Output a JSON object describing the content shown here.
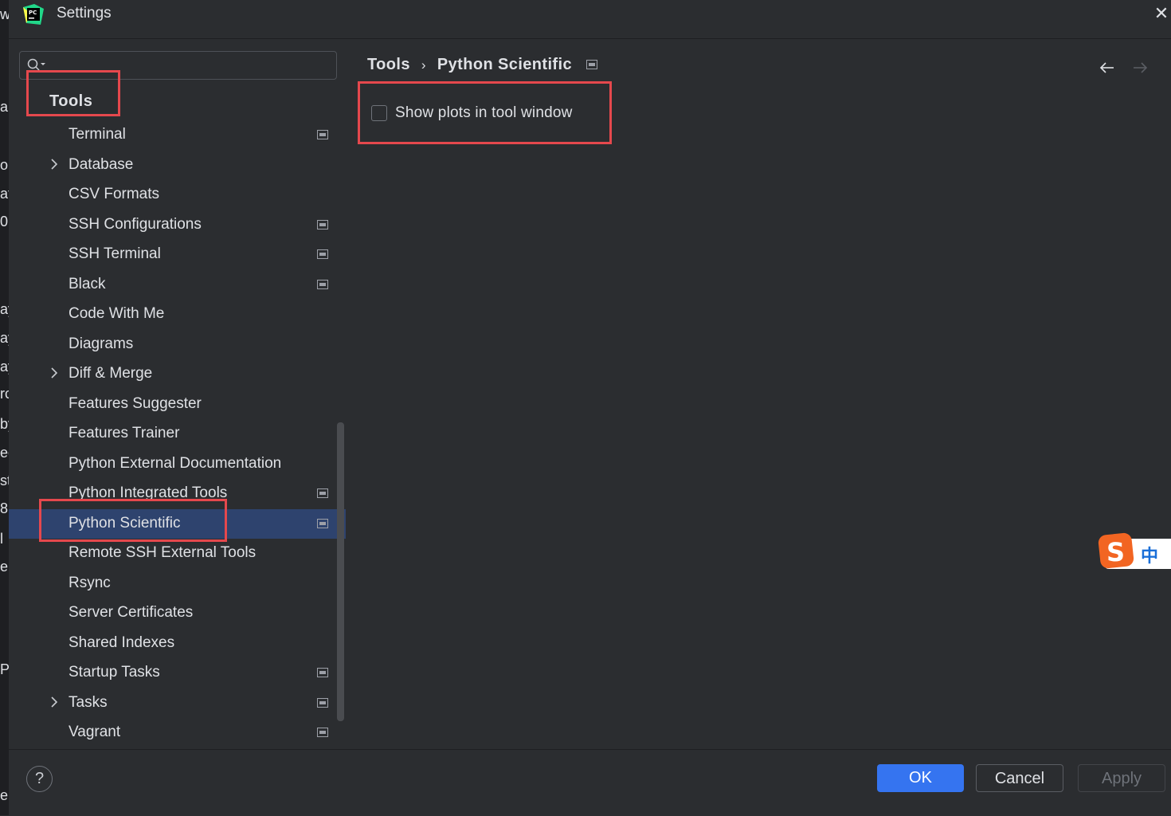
{
  "window": {
    "title": "Settings"
  },
  "sidebar": {
    "search_placeholder": "",
    "section_title": "Tools",
    "items": [
      {
        "label": "Terminal",
        "project_badge": true,
        "expandable": false,
        "selected": false
      },
      {
        "label": "Database",
        "project_badge": false,
        "expandable": true,
        "selected": false
      },
      {
        "label": "CSV Formats",
        "project_badge": false,
        "expandable": false,
        "selected": false
      },
      {
        "label": "SSH Configurations",
        "project_badge": true,
        "expandable": false,
        "selected": false
      },
      {
        "label": "SSH Terminal",
        "project_badge": true,
        "expandable": false,
        "selected": false
      },
      {
        "label": "Black",
        "project_badge": true,
        "expandable": false,
        "selected": false
      },
      {
        "label": "Code With Me",
        "project_badge": false,
        "expandable": false,
        "selected": false
      },
      {
        "label": "Diagrams",
        "project_badge": false,
        "expandable": false,
        "selected": false
      },
      {
        "label": "Diff & Merge",
        "project_badge": false,
        "expandable": true,
        "selected": false
      },
      {
        "label": "Features Suggester",
        "project_badge": false,
        "expandable": false,
        "selected": false
      },
      {
        "label": "Features Trainer",
        "project_badge": false,
        "expandable": false,
        "selected": false
      },
      {
        "label": "Python External Documentation",
        "project_badge": false,
        "expandable": false,
        "selected": false
      },
      {
        "label": "Python Integrated Tools",
        "project_badge": true,
        "expandable": false,
        "selected": false
      },
      {
        "label": "Python Scientific",
        "project_badge": true,
        "expandable": false,
        "selected": true
      },
      {
        "label": "Remote SSH External Tools",
        "project_badge": false,
        "expandable": false,
        "selected": false
      },
      {
        "label": "Rsync",
        "project_badge": false,
        "expandable": false,
        "selected": false
      },
      {
        "label": "Server Certificates",
        "project_badge": false,
        "expandable": false,
        "selected": false
      },
      {
        "label": "Shared Indexes",
        "project_badge": false,
        "expandable": false,
        "selected": false
      },
      {
        "label": "Startup Tasks",
        "project_badge": true,
        "expandable": false,
        "selected": false
      },
      {
        "label": "Tasks",
        "project_badge": true,
        "expandable": true,
        "selected": false
      },
      {
        "label": "Vagrant",
        "project_badge": true,
        "expandable": false,
        "selected": false
      }
    ]
  },
  "breadcrumb": {
    "parent": "Tools",
    "separator": "›",
    "current": "Python Scientific"
  },
  "content": {
    "checkbox_label": "Show plots in tool window",
    "checked": false
  },
  "footer": {
    "help": "?",
    "ok": "OK",
    "cancel": "Cancel",
    "apply": "Apply"
  },
  "ime": {
    "label": "中"
  },
  "left_strip_chars": [
    "w",
    "a",
    "o",
    "at",
    "0",
    "ay",
    "ay",
    "ay",
    "rc",
    "by",
    "ec",
    "st",
    "8",
    "l",
    "e",
    "P",
    "e("
  ],
  "colors": {
    "background": "#2b2d30",
    "selection": "#2e436e",
    "accent": "#3574f0",
    "highlight": "#e5484d"
  }
}
